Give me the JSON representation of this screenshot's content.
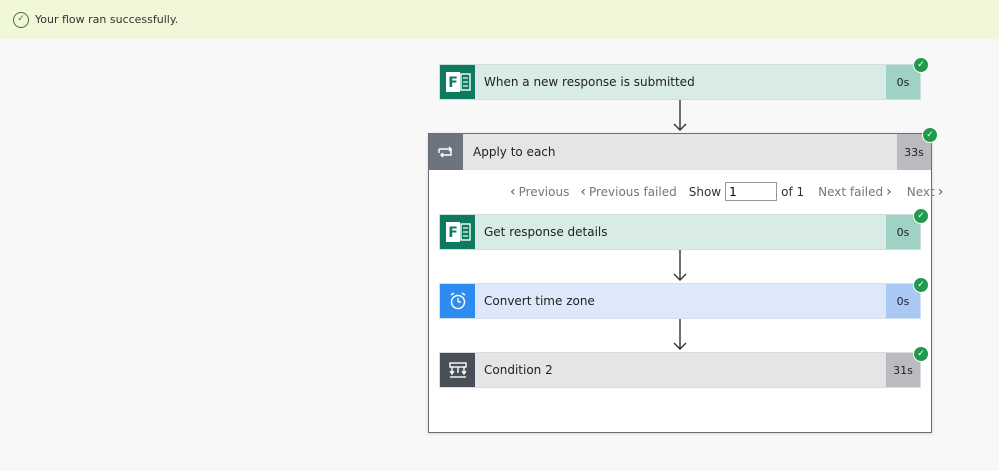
{
  "banner": {
    "message": "Your flow ran successfully."
  },
  "trigger": {
    "title": "When a new response is submitted",
    "duration": "0s",
    "icon": "forms-icon"
  },
  "loop": {
    "title": "Apply to each",
    "duration": "33s",
    "icon": "loop-icon",
    "pager": {
      "previous": "Previous",
      "previous_failed": "Previous failed",
      "show": "Show",
      "current": "1",
      "of": "of 1",
      "next_failed": "Next failed",
      "next": "Next"
    },
    "actions": [
      {
        "title": "Get response details",
        "duration": "0s",
        "icon": "forms-icon"
      },
      {
        "title": "Convert time zone",
        "duration": "0s",
        "icon": "clock-icon"
      },
      {
        "title": "Condition 2",
        "duration": "31s",
        "icon": "condition-icon"
      }
    ]
  },
  "colors": {
    "banner_bg": "#f1f7d9",
    "forms_green": "#0d7a5f",
    "forms_card": "#d8ebe6",
    "forms_dur": "#9fd1c4",
    "clock_blue": "#2d8cf0",
    "clock_card": "#dde9fb",
    "clock_dur": "#a9c9f4",
    "condition_dark": "#484f58",
    "condition_card": "#e4e5e7",
    "condition_dur": "#b9bbbe",
    "success_green": "#229a4e"
  }
}
